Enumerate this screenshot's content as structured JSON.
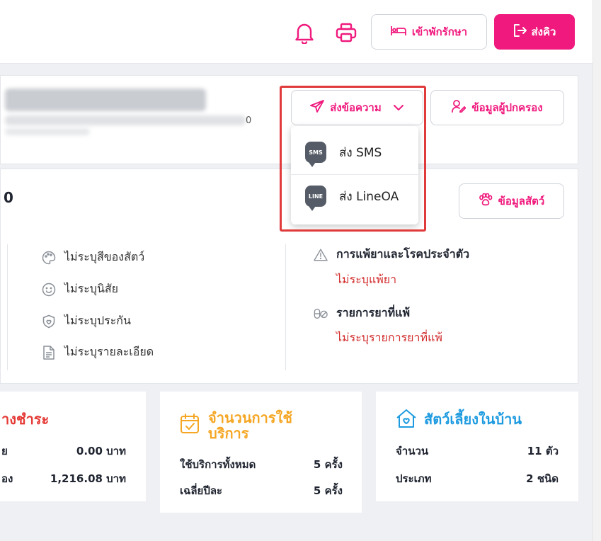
{
  "topbar": {
    "bell_icon": "bell-icon",
    "print_icon": "printer-icon",
    "admit_label": "เข้าพักรักษา",
    "queue_label": "ส่งคิว"
  },
  "owner": {
    "send_message_label": "ส่งข้อความ",
    "guardian_label": "ข้อมูลผู้ปกครอง",
    "blurred_suffix": "0"
  },
  "send_menu": {
    "items": [
      {
        "badge": "SMS",
        "label": "ส่ง SMS"
      },
      {
        "badge": "LINE",
        "label": "ส่ง LineOA"
      }
    ]
  },
  "pet": {
    "id_fragment": "0",
    "pet_info_label": "ข้อมูลสัตว์",
    "details": [
      {
        "icon": "palette-icon",
        "text": "ไม่ระบุสีของสัตว์"
      },
      {
        "icon": "smile-icon",
        "text": "ไม่ระบุนิสัย"
      },
      {
        "icon": "shield-icon",
        "text": "ไม่ระบุประกัน"
      },
      {
        "icon": "document-icon",
        "text": "ไม่ระบุรายละเอียด"
      }
    ],
    "allergy_title": "การแพ้ยาและโรคประจำตัว",
    "allergy_value": "ไม่ระบุแพ้ยา",
    "drug_title": "รายการยาที่แพ้",
    "drug_value": "ไม่ระบุรายการยาที่แพ้"
  },
  "stats": {
    "payment": {
      "title": "างชำระ",
      "rows": [
        {
          "label": "ย",
          "value": "0.00 บาท"
        },
        {
          "label": "อง",
          "value": "1,216.08 บาท"
        }
      ]
    },
    "usage": {
      "title_line1": "จำนวนการใช้",
      "title_line2": "บริการ",
      "rows": [
        {
          "label": "ใช้บริการทั้งหมด",
          "value": "5 ครั้ง"
        },
        {
          "label": "เฉลี่ยปีละ",
          "value": "5 ครั้ง"
        }
      ]
    },
    "household": {
      "title": "สัตว์เลี้ยงในบ้าน",
      "rows": [
        {
          "label": "จำนวน",
          "value": "11 ตัว"
        },
        {
          "label": "ประเภท",
          "value": "2 ชนิด"
        }
      ]
    }
  },
  "colors": {
    "accent": "#f0197d",
    "danger": "#d32f2f",
    "payment_title": "#e53935",
    "usage_title": "#f5a623",
    "household_title": "#1e9be0"
  }
}
